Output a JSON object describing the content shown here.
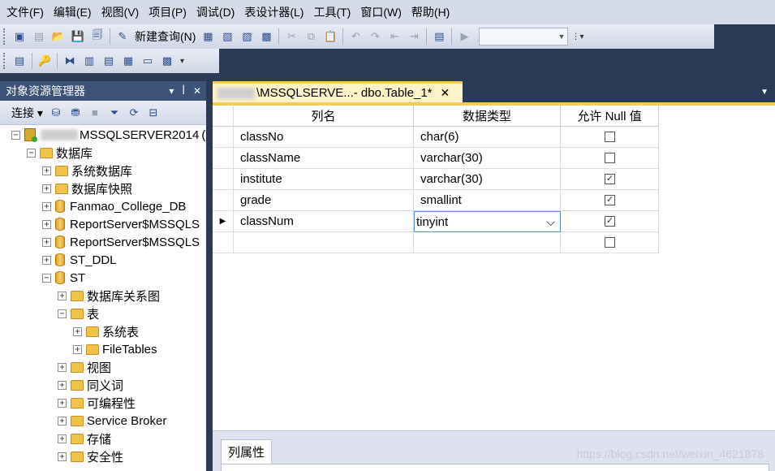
{
  "menu": [
    "文件(F)",
    "编辑(E)",
    "视图(V)",
    "项目(P)",
    "调试(D)",
    "表设计器(L)",
    "工具(T)",
    "窗口(W)",
    "帮助(H)"
  ],
  "toolbar": {
    "new_query_label": "新建查询(N)"
  },
  "object_explorer": {
    "title": "对象资源管理器",
    "pin_glyph": "▾ ᵖ ✕",
    "connect_label": "连接",
    "tree": [
      {
        "label": "MSSQLSERVER2014",
        "icon": "server-icon",
        "level": 0,
        "expander": "−",
        "blurred_prefix": true,
        "suffix": "("
      },
      {
        "label": "数据库",
        "icon": "folder-icon",
        "level": 1,
        "expander": "−"
      },
      {
        "label": "系统数据库",
        "icon": "folder-icon",
        "level": 2,
        "expander": "+"
      },
      {
        "label": "数据库快照",
        "icon": "folder-icon",
        "level": 2,
        "expander": "+"
      },
      {
        "label": "Fanmao_College_DB",
        "icon": "database-icon",
        "level": 2,
        "expander": "+"
      },
      {
        "label": "ReportServer$MSSQLS",
        "icon": "database-icon",
        "level": 2,
        "expander": "+"
      },
      {
        "label": "ReportServer$MSSQLS",
        "icon": "database-icon",
        "level": 2,
        "expander": "+"
      },
      {
        "label": "ST_DDL",
        "icon": "database-icon",
        "level": 2,
        "expander": "+"
      },
      {
        "label": "ST",
        "icon": "database-icon",
        "level": 2,
        "expander": "−"
      },
      {
        "label": "数据库关系图",
        "icon": "folder-icon",
        "level": 3,
        "expander": "+"
      },
      {
        "label": "表",
        "icon": "folder-icon",
        "level": 3,
        "expander": "−"
      },
      {
        "label": "系统表",
        "icon": "folder-icon",
        "level": 4,
        "expander": "+"
      },
      {
        "label": "FileTables",
        "icon": "folder-icon",
        "level": 4,
        "expander": "+"
      },
      {
        "label": "视图",
        "icon": "folder-icon",
        "level": 3,
        "expander": "+"
      },
      {
        "label": "同义词",
        "icon": "folder-icon",
        "level": 3,
        "expander": "+"
      },
      {
        "label": "可编程性",
        "icon": "folder-icon",
        "level": 3,
        "expander": "+"
      },
      {
        "label": "Service Broker",
        "icon": "folder-icon",
        "level": 3,
        "expander": "+"
      },
      {
        "label": "存储",
        "icon": "folder-icon",
        "level": 3,
        "expander": "+"
      },
      {
        "label": "安全性",
        "icon": "folder-icon",
        "level": 3,
        "expander": "+"
      }
    ]
  },
  "document": {
    "tab_title": "\\MSSQLSERVE...- dbo.Table_1*",
    "close_glyph": "✕",
    "columns": {
      "name": "列名",
      "type": "数据类型",
      "nullable": "允许 Null 值"
    },
    "rows": [
      {
        "name": "classNo",
        "type": "char(6)",
        "allow_null": false
      },
      {
        "name": "className",
        "type": "varchar(30)",
        "allow_null": false
      },
      {
        "name": "institute",
        "type": "varchar(30)",
        "allow_null": true
      },
      {
        "name": "grade",
        "type": "smallint",
        "allow_null": true
      },
      {
        "name": "classNum",
        "type": "tinyint",
        "allow_null": true,
        "current": true,
        "editing_type": true
      },
      {
        "name": "",
        "type": "",
        "allow_null": false
      }
    ],
    "properties_tab": "列属性",
    "watermark": "https://blog.csdn.net/weixin_4621878"
  }
}
